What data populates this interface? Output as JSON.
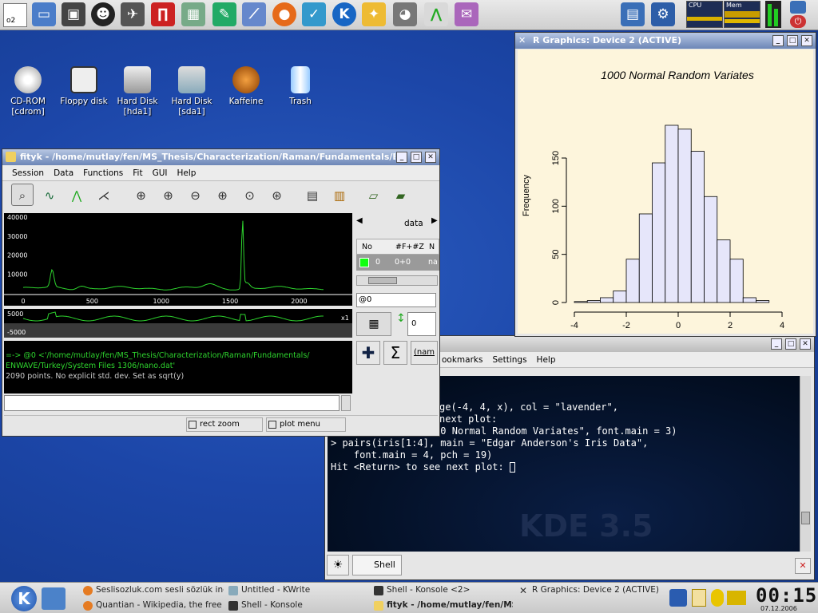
{
  "panel": {
    "pager": "o2"
  },
  "desktop_icons": [
    {
      "label": "CD-ROM\n[cdrom]"
    },
    {
      "label": "Floppy disk"
    },
    {
      "label": "Hard Disk\n[hda1]"
    },
    {
      "label": "Hard Disk\n[sda1]"
    },
    {
      "label": "Kaffeine"
    },
    {
      "label": "Trash"
    }
  ],
  "monitor": {
    "cpu": "CPU",
    "mem": "Mem"
  },
  "rgraphics": {
    "title": "R Graphics: Device 2 (ACTIVE)",
    "chart_data": {
      "type": "bar",
      "title": "1000 Normal Random Variates",
      "xlabel": "",
      "ylabel": "Frequency",
      "xlim": [
        -4,
        4
      ],
      "ylim": [
        0,
        150
      ],
      "xticks": [
        "-4",
        "-2",
        "0",
        "2",
        "4"
      ],
      "yticks": [
        "0",
        "50",
        "100",
        "150"
      ],
      "bin_edges": [
        -4,
        -3.5,
        -3,
        -2.5,
        -2,
        -1.5,
        -1,
        -0.5,
        0,
        0.5,
        1,
        1.5,
        2,
        2.5,
        3,
        3.5
      ],
      "values": [
        1,
        2,
        5,
        12,
        45,
        92,
        145,
        184,
        180,
        157,
        110,
        65,
        45,
        5,
        2
      ]
    }
  },
  "fityk": {
    "title": "fityk - /home/mutlay/fen/MS_Thesis/Characterization/Raman/Fundamentals/ENWA",
    "menus": [
      "Session",
      "Data",
      "Functions",
      "Fit",
      "GUI",
      "Help"
    ],
    "plot": {
      "yticks": [
        "40000",
        "30000",
        "20000",
        "10000"
      ],
      "xticks": [
        "0",
        "500",
        "1000",
        "1500",
        "2000"
      ],
      "aux_ticks": [
        "5000",
        "-5000"
      ],
      "aux_scale": "x1"
    },
    "output_lines": [
      "=-> @0 <'/home/mutlay/fen/MS_Thesis/Characterization/Raman/Fundamentals/",
      "ENWAVE/Turkey/System Files 1306/nano.dat'",
      "2090 points. No explicit std. dev. Set as sqrt(y)"
    ],
    "status": {
      "left_btn": "rect zoom",
      "right_btn": "plot menu"
    },
    "side": {
      "data_label": "data",
      "col_no": "No",
      "col_fz": "#F+#Z",
      "col_n": "N",
      "row_no": "0",
      "row_fz": "0+0",
      "row_n": "na",
      "dataset": "@0",
      "spin_val": "0",
      "name_btn": "(nam"
    }
  },
  "konsole": {
    "menus": [
      "ookmarks",
      "Settings",
      "Help"
    ],
    "lines": [
      "ge(-4, 4, x), col = \"lavender\",",
      "",
      "next plot:",
      "",
      "> title(main = \"1000 Normal Random Variates\", font.main = 3)",
      "",
      "> pairs(iris[1:4], main = \"Edgar Anderson's Iris Data\",",
      "    font.main = 4, pch = 19)",
      "Hit <Return> to see next plot: "
    ],
    "watermark": "KDE 3.5",
    "tab": "Shell"
  },
  "taskbar": {
    "tasks": [
      "Seslisozluk.com sesli sözlük ingil",
      "Quantian - Wikipedia, the free e",
      "Untitled - KWrite",
      "Shell - Konsole",
      "Shell - Konsole <2>",
      "fityk - /home/mutlay/fen/MS",
      "R Graphics: Device 2 (ACTIVE)"
    ],
    "clock": "00:15",
    "date": "07.12.2006"
  }
}
